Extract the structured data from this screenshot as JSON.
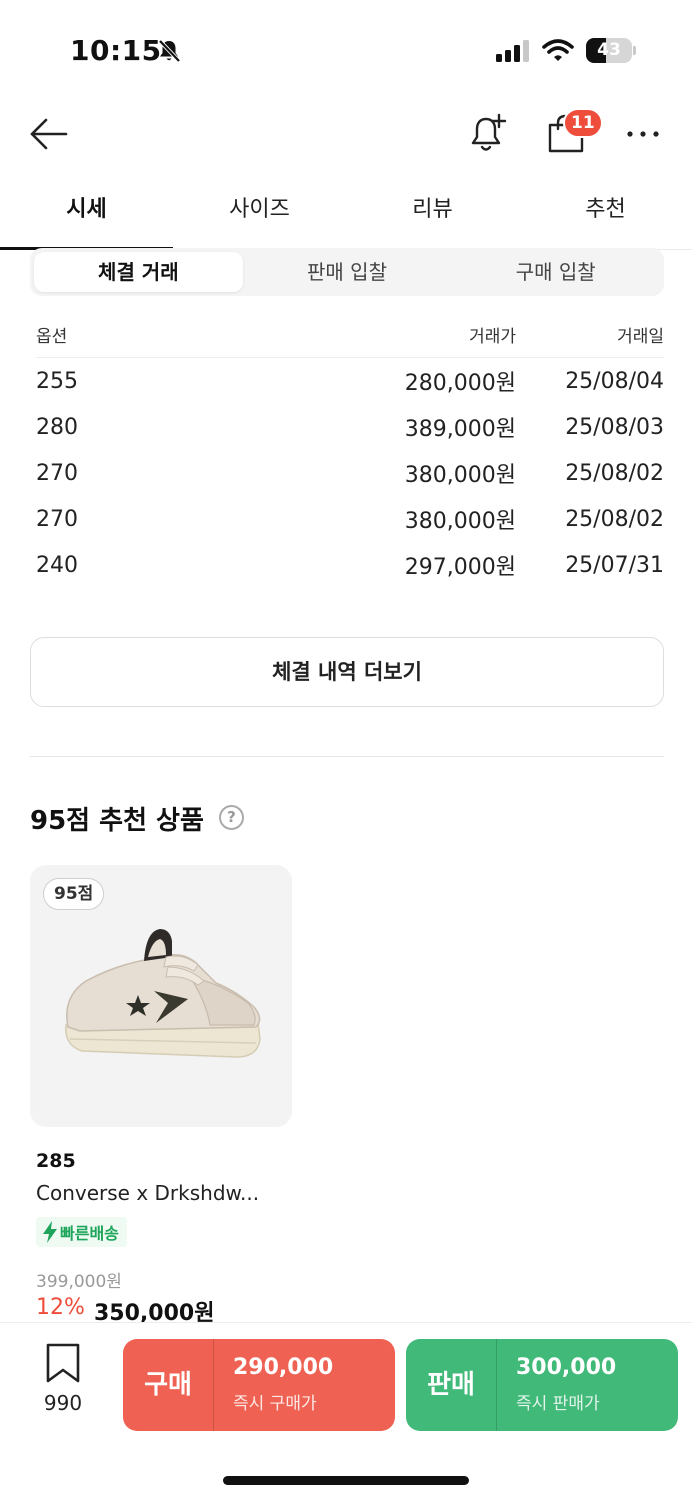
{
  "status_bar": {
    "time": "10:15",
    "battery": "43",
    "battery_level": 0.43
  },
  "nav": {
    "cart_badge": "11"
  },
  "tabs": [
    {
      "label": "시세",
      "active": true
    },
    {
      "label": "사이즈",
      "active": false
    },
    {
      "label": "리뷰",
      "active": false
    },
    {
      "label": "추천",
      "active": false
    }
  ],
  "segment": [
    {
      "label": "체결 거래",
      "active": true
    },
    {
      "label": "판매 입찰",
      "active": false
    },
    {
      "label": "구매 입찰",
      "active": false
    }
  ],
  "transactions": {
    "headers": {
      "option": "옵션",
      "price": "거래가",
      "date": "거래일"
    },
    "rows": [
      {
        "option": "255",
        "price": "280,000원",
        "date": "25/08/04"
      },
      {
        "option": "280",
        "price": "389,000원",
        "date": "25/08/03"
      },
      {
        "option": "270",
        "price": "380,000원",
        "date": "25/08/02"
      },
      {
        "option": "270",
        "price": "380,000원",
        "date": "25/08/02"
      },
      {
        "option": "240",
        "price": "297,000원",
        "date": "25/07/31"
      }
    ]
  },
  "more_history_label": "체결 내역 더보기",
  "recommend": {
    "title": "95점 추천 상품",
    "help": "?",
    "product": {
      "score": "95점",
      "size": "285",
      "name": "Converse x Drkshdw...",
      "tag": "빠른배송",
      "original_price": "399,000원",
      "discount": "12%",
      "price": "350,000원"
    }
  },
  "bottom": {
    "bookmark_count": "990",
    "buy": {
      "label": "구매",
      "price": "290,000",
      "sub": "즉시 구매가"
    },
    "sell": {
      "label": "판매",
      "price": "300,000",
      "sub": "즉시 판매가"
    }
  },
  "colors": {
    "buy": "#ef6253",
    "sell": "#41b979",
    "discount": "#ef4d3c",
    "fast": "#1fa55b"
  },
  "icons": [
    "back-arrow-icon",
    "bell-plus-icon",
    "shopping-bag-icon",
    "more-icon",
    "bookmark-icon",
    "lightning-icon",
    "bell-off-icon",
    "signal-icon",
    "wifi-icon"
  ]
}
